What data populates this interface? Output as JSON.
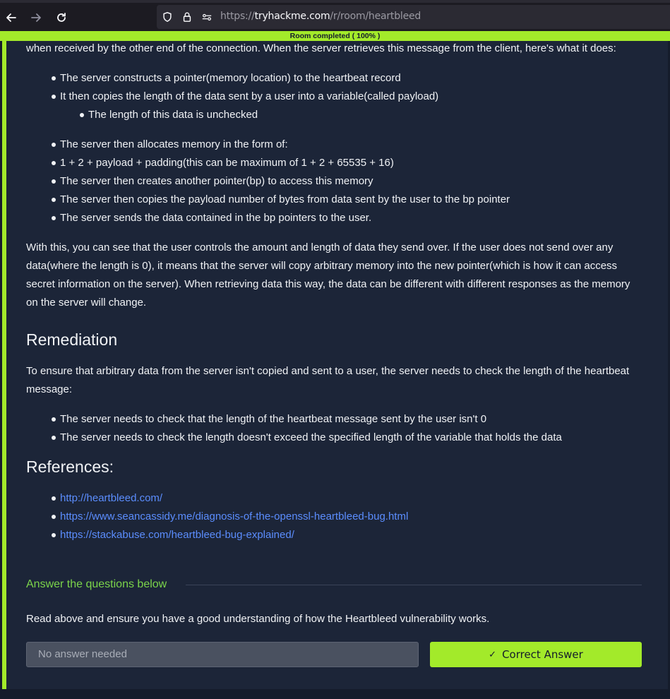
{
  "browser": {
    "url_prefix": "https://",
    "url_domain": "tryhackme.com",
    "url_path": "/r/room/heartbleed"
  },
  "progress": {
    "label": "Room completed ( 100% )",
    "value": 100
  },
  "content": {
    "intro": "when received by the other end of the connection. When the server retrieves this message from the client, here's what it does:",
    "steps": [
      "The server constructs a pointer(memory location) to the heartbeat record",
      "It then copies the length of the data sent by a user into a variable(called payload)"
    ],
    "substep": "The length of this data is unchecked",
    "steps2": [
      "The server then allocates memory in the form of:",
      "1 + 2 + payload + padding(this can be maximum of 1 + 2 + 65535 + 16)",
      "The server then creates another pointer(bp) to access this memory",
      "The server then copies the payload number of bytes from data sent by the user to the bp pointer",
      "The server sends the data contained in the bp pointers to the user."
    ],
    "explanation_lines": [
      "With this, you can see that the user controls the amount and length of data they send over. If the user does not send over any",
      "data(where the length is 0), it means that the server will copy arbitrary memory into the new pointer(which is how it can access",
      "secret information on the server). When retrieving data this way, the data can be different with different responses as the memory",
      "on the server will change."
    ],
    "remediation_heading": "Remediation",
    "remediation_lines": [
      "To ensure that arbitrary data from the server isn't copied and sent to a user, the server needs to check the length of the heartbeat",
      "message:"
    ],
    "remediation_items": [
      "The server needs to check that the length of the heartbeat message sent by the user isn't 0",
      "The server needs to check the length doesn't exceed the specified length of the variable that holds the data"
    ],
    "references_heading": "References:",
    "references": [
      "http://heartbleed.com/",
      "https://www.seancassidy.me/diagnosis-of-the-openssl-heartbleed-bug.html",
      "https://stackabuse.com/heartbleed-bug-explained/"
    ]
  },
  "questions": {
    "heading": "Answer the questions below",
    "question": "Read above and ensure you have a good understanding of how the Heartbleed vulnerability works.",
    "answer_placeholder": "No answer needed",
    "button_label": "Correct Answer"
  },
  "colors": {
    "accent": "#a3ea2a",
    "link": "#5b8dfe",
    "panel": "#1c2538",
    "heading_green": "#7bd44a"
  }
}
